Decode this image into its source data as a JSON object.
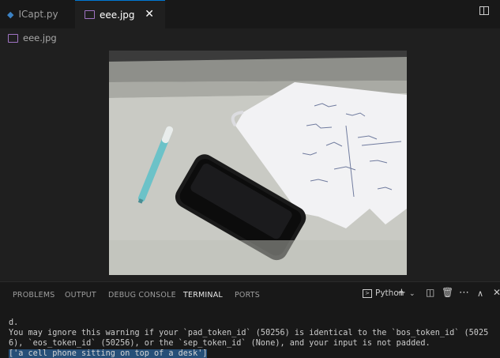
{
  "tabs": [
    {
      "label": "ICapt.py",
      "icon": "python-file-icon",
      "active": false
    },
    {
      "label": "eee.jpg",
      "icon": "image-file-icon",
      "active": true
    }
  ],
  "tab_close_glyph": "✕",
  "breadcrumb": {
    "label": "eee.jpg",
    "icon": "image-file-icon"
  },
  "panel": {
    "tabs": [
      "PROBLEMS",
      "OUTPUT",
      "DEBUG CONSOLE",
      "TERMINAL",
      "PORTS"
    ],
    "selected": "TERMINAL",
    "terminal_name": "Python",
    "actions": [
      "plus-icon",
      "chevron-down-icon",
      "split-terminal-icon",
      "trash-icon",
      "more-icon",
      "chevron-up-icon",
      "close-icon"
    ]
  },
  "terminal": {
    "lines": [
      "d.",
      "You may ignore this warning if your `pad_token_id` (50256) is identical to the `bos_token_id` (5025",
      "6), `eos_token_id` (50256), or the `sep_token_id` (None), and your input is not padded."
    ],
    "highlighted": "['a cell phone sitting on top of a desk']"
  },
  "colors": {
    "accent": "#0078d4",
    "selection": "#264f78",
    "background": "#1f1f1f"
  }
}
